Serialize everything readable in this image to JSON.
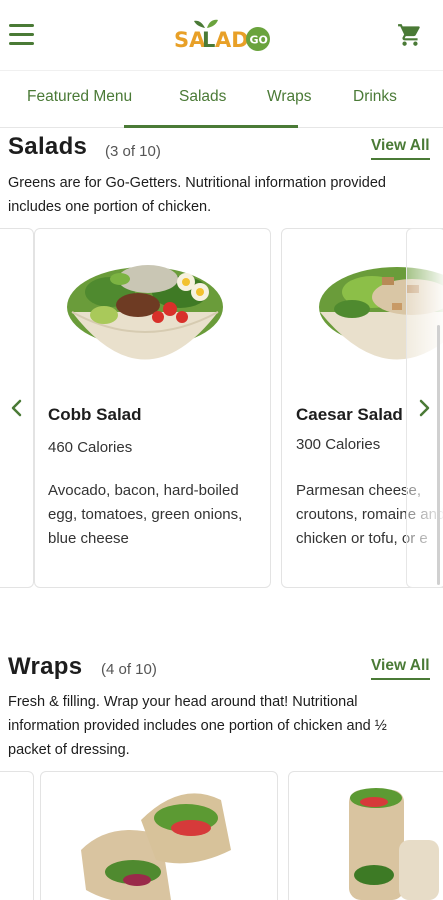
{
  "header": {
    "logo_text": "SALAD GO",
    "menu_icon": "hamburger-menu-icon",
    "cart_icon": "shopping-cart-icon",
    "brand_green": "#4a7a36",
    "brand_orange": "#e8a027"
  },
  "tabs": [
    {
      "label": "Featured Menu"
    },
    {
      "label": "Salads"
    },
    {
      "label": "Wraps"
    },
    {
      "label": "Drinks"
    }
  ],
  "salads": {
    "title": "Salads",
    "count": "(3 of 10)",
    "view_all": "View All",
    "description": "Greens are for Go-Getters. Nutritional information provided includes one portion of chicken.",
    "items": [
      {
        "name": "Cobb Salad",
        "calories": "460 Calories",
        "description": "Avocado, bacon, hard-boiled egg, tomatoes, green onions, blue cheese"
      },
      {
        "name": "Caesar Salad",
        "calories": "300 Calories",
        "description": "Parmesan cheese, croutons, romaine and chicken or tofu, or e"
      }
    ]
  },
  "wraps": {
    "title": "Wraps",
    "count": "(4 of 10)",
    "view_all": "View All",
    "description": "Fresh & filling. Wrap your head around that! Nutritional information provided includes one portion of chicken and ½ packet of dressing."
  }
}
